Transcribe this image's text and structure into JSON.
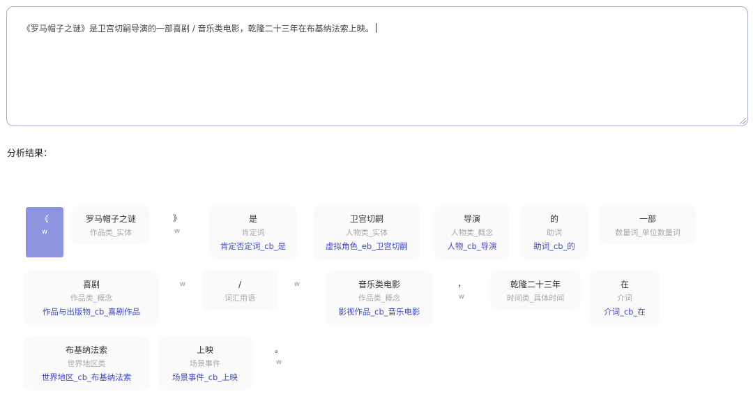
{
  "input": {
    "text": "《罗马帽子之谜》是卫宫切嗣导演的一部喜剧 / 音乐类电影，乾隆二十三年在布基纳法索上映。"
  },
  "result_label": "分析结果：",
  "tokens": [
    {
      "text": "《",
      "category": "w",
      "link": ""
    },
    {
      "text": "罗马帽子之谜",
      "category": "作品类_实体",
      "link": ""
    },
    {
      "text": "》",
      "category": "w",
      "link": ""
    },
    {
      "text": "是",
      "category": "肯定词",
      "link": "肯定否定词_cb_是"
    },
    {
      "text": "卫宫切嗣",
      "category": "人物类_实体",
      "link": "虚拟角色_eb_卫宫切嗣"
    },
    {
      "text": "导演",
      "category": "人物类_概念",
      "link": "人物_cb_导演"
    },
    {
      "text": "的",
      "category": "助词",
      "link": "助词_cb_的"
    },
    {
      "text": "一部",
      "category": "数量词_单位数量词",
      "link": ""
    },
    {
      "text": "喜剧",
      "category": "作品类_概念",
      "link": "作品与出版物_cb_喜剧作品"
    },
    {
      "text": "",
      "category": "w",
      "link": ""
    },
    {
      "text": "/",
      "category": "词汇用语",
      "link": ""
    },
    {
      "text": "",
      "category": "w",
      "link": ""
    },
    {
      "text": "音乐类电影",
      "category": "作品类_概念",
      "link": "影视作品_cb_音乐电影"
    },
    {
      "text": "，",
      "category": "w",
      "link": ""
    },
    {
      "text": "乾隆二十三年",
      "category": "时间类_具体时间",
      "link": ""
    },
    {
      "text": "在",
      "category": "介词",
      "link": "介词_cb_在"
    },
    {
      "text": "布基纳法索",
      "category": "世界地区类",
      "link": "世界地区_cb_布基纳法索"
    },
    {
      "text": "上映",
      "category": "场景事件",
      "link": "场景事件_cb_上映"
    },
    {
      "text": "。",
      "category": "w",
      "link": ""
    }
  ]
}
